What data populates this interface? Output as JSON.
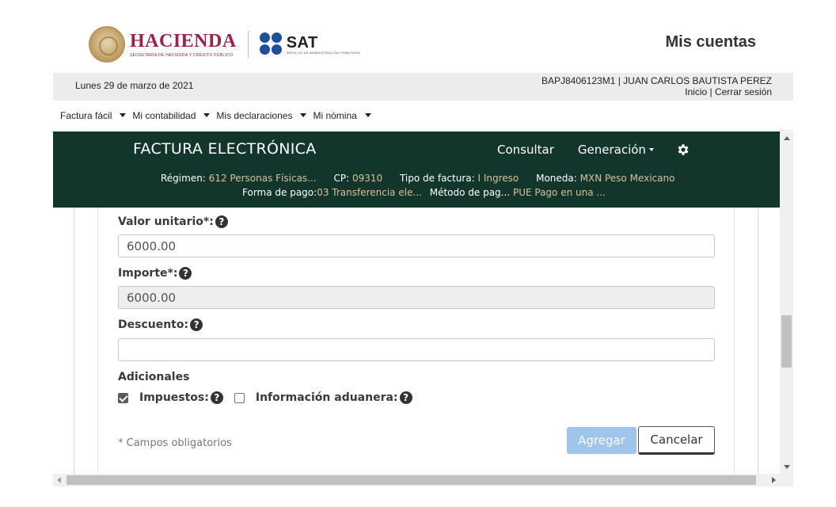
{
  "header": {
    "hacienda_name": "HACIENDA",
    "hacienda_subtitle": "SECRETARÍA DE HACIENDA Y CRÉDITO PÚBLICO",
    "sat_name": "SAT",
    "sat_subtitle": "SERVICIO DE ADMINISTRACIÓN TRIBUTARIA",
    "mis_cuentas": "Mis cuentas"
  },
  "info_bar": {
    "date": "Lunes 29 de marzo de 2021",
    "user": "BAPJ8406123M1 | JUAN CARLOS BAUTISTA PEREZ",
    "inicio": "Inicio",
    "separator": " | ",
    "cerrar_sesion": "Cerrar sesión"
  },
  "nav": {
    "items": [
      {
        "label": "Factura fácil"
      },
      {
        "label": "Mi contabilidad"
      },
      {
        "label": "Mis declaraciones"
      },
      {
        "label": "Mi nómina"
      }
    ]
  },
  "app": {
    "title": "FACTURA ELECTRÓNICA",
    "consultar": "Consultar",
    "generacion": "Generación",
    "regimen_label": "Régimen:",
    "regimen_value": "612 Personas Físicas...",
    "cp_label": "CP:",
    "cp_value": "09310",
    "tipo_label": "Tipo de factura:",
    "tipo_value": "I Ingreso",
    "moneda_label": "Moneda:",
    "moneda_value": "MXN Peso Mexicano",
    "forma_label": "Forma de pago:",
    "forma_value": "03 Transferencia ele...",
    "metodo_label": "Método de pag...",
    "metodo_value": "PUE Pago en una ..."
  },
  "form": {
    "valor_unitario_label": "Valor unitario*:",
    "valor_unitario_value": "6000.00",
    "importe_label": "Importe*:",
    "importe_value": "6000.00",
    "descuento_label": "Descuento:",
    "descuento_value": "",
    "adicionales_label": "Adicionales",
    "impuestos_label": "Impuestos:",
    "impuestos_checked": true,
    "aduanera_label": "Información aduanera:",
    "aduanera_checked": false,
    "help_glyph": "?",
    "required_note": "* Campos obligatorios",
    "agregar": "Agregar",
    "cancelar": "Cancelar"
  },
  "colors": {
    "brand_hacienda": "#9b2247",
    "sat_blue": "#1f4e9a",
    "app_header_bg": "#12352c",
    "meta_value": "#d8c19a",
    "agregar_bg": "#9fc5ea"
  }
}
